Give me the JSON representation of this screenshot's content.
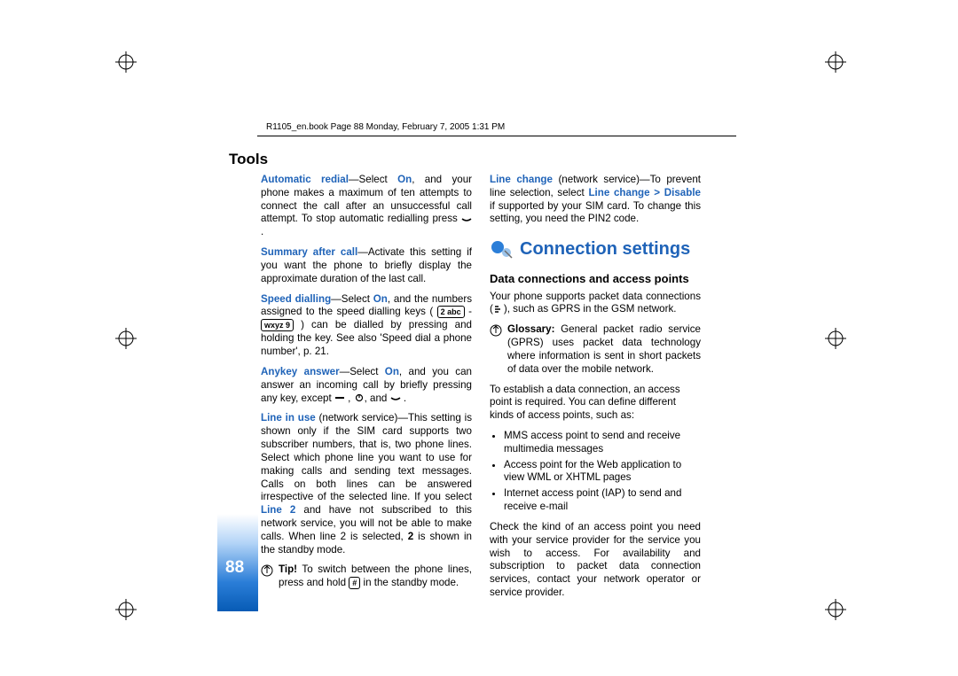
{
  "header": {
    "path": "R1105_en.book  Page 88  Monday, February 7, 2005  1:31 PM"
  },
  "sidebar": {
    "label": "Tools",
    "page_number": "88"
  },
  "left_column": {
    "automatic_redial_label": "Automatic redial",
    "automatic_redial_text1": "—Select ",
    "on1": "On",
    "automatic_redial_text2": ", and your phone makes a maximum of ten attempts to connect the call after an unsuccessful call attempt. To stop automatic redialling press ",
    "summary_after_call_label": "Summary after call",
    "summary_after_call_text": "—Activate this setting if you want the phone to briefly display the approximate duration of the last call.",
    "speed_dialling_label": "Speed dialling",
    "speed_dialling_text1": "—Select ",
    "on2": "On",
    "speed_dialling_text2": ", and the numbers assigned to the speed dialling keys ( ",
    "key2": "2 abc",
    "dash": " - ",
    "key9": "wxyz 9",
    "speed_dialling_text3": " ) can be dialled by pressing and holding the key. See also 'Speed dial a phone number', p. 21.",
    "anykey_label": "Anykey answer",
    "anykey_text1": "—Select ",
    "on3": "On",
    "anykey_text2": ", and you can answer an incoming call by briefly pressing any key, except ",
    "anykey_text3": ", and ",
    "line_in_use_label": "Line in use",
    "line_in_use_text1": " (network service)—This setting is shown only if the SIM card supports two subscriber numbers, that is, two phone lines. Select which phone line you want to use for making calls and sending text messages. Calls on both lines can be answered irrespective of the selected line. If you select ",
    "line2": "Line 2",
    "line_in_use_text2": " and have not subscribed to this network service, you will not be able to make calls. When line 2 is selected, ",
    "line2_icon": "2",
    "line_in_use_text3": " is shown in the standby mode.",
    "tip_label": "Tip!",
    "tip_text": " To switch between the phone lines, press and hold ",
    "tip_hash": "#",
    "tip_text2": " in the standby mode."
  },
  "right_column": {
    "line_change_label": "Line change",
    "line_change_text1": " (network service)—To prevent line selection, select ",
    "line_change_disable": "Line change > Disable",
    "line_change_text2": " if supported by your SIM card. To change this setting, you need the PIN2 code.",
    "connection_heading": "Connection settings",
    "data_heading": "Data connections and access points",
    "data_text1": "Your phone supports packet data connections (",
    "data_text2": "), such as GPRS in the GSM network.",
    "glossary_label": "Glossary:",
    "glossary_text": " General packet radio service (GPRS) uses packet data technology where information is sent in short packets of data over the mobile network.",
    "establish_text": "To establish a data connection, an access point is required. You can define different kinds of access points, such as:",
    "bullet1": "MMS access point to send and receive multimedia messages",
    "bullet2": "Access point for the Web application to view WML or XHTML pages",
    "bullet3": "Internet access point (IAP) to send and receive e-mail",
    "check_text": "Check the kind of an access point you need with your service provider for the service you wish to access. For availability and subscription to packet data connection services, contact your network operator or service provider."
  }
}
